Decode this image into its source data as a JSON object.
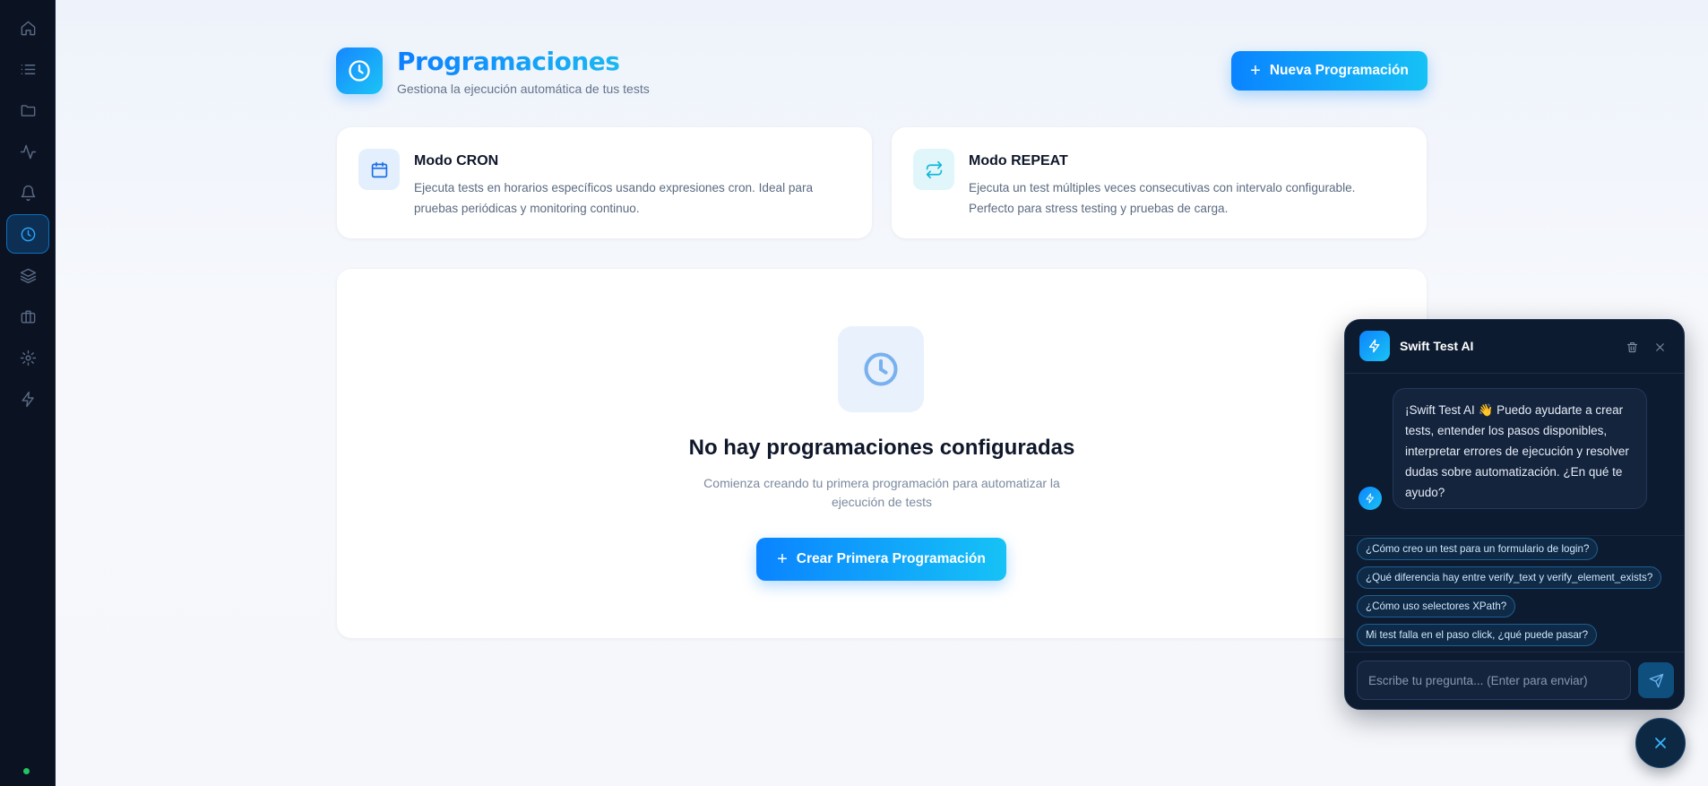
{
  "sidebar": {
    "items": [
      {
        "icon": "home-icon"
      },
      {
        "icon": "list-icon"
      },
      {
        "icon": "folder-icon"
      },
      {
        "icon": "activity-icon"
      },
      {
        "icon": "bell-icon"
      },
      {
        "icon": "clock-icon",
        "active": true
      },
      {
        "icon": "layers-icon"
      },
      {
        "icon": "briefcase-icon"
      },
      {
        "icon": "settings-icon"
      },
      {
        "icon": "zap-icon"
      }
    ],
    "status_color": "#22c55e"
  },
  "header": {
    "icon": "clock-icon",
    "title": "Programaciones",
    "subtitle": "Gestiona la ejecución automática de tus tests",
    "new_button_label": "Nueva Programación"
  },
  "modes": {
    "cron": {
      "icon": "calendar-icon",
      "title": "Modo CRON",
      "description": "Ejecuta tests en horarios específicos usando expresiones cron. Ideal para pruebas periódicas y monitoring continuo."
    },
    "repeat": {
      "icon": "repeat-icon",
      "title": "Modo REPEAT",
      "description": "Ejecuta un test múltiples veces consecutivas con intervalo configurable. Perfecto para stress testing y pruebas de carga."
    }
  },
  "empty_state": {
    "icon": "clock-icon",
    "title": "No hay programaciones configuradas",
    "description": "Comienza creando tu primera programación para automatizar la ejecución de tests",
    "button_label": "Crear Primera Programación"
  },
  "chat": {
    "title": "Swift Test AI",
    "greeting": "¡Swift Test AI 👋 Puedo ayudarte a crear tests, entender los pasos disponibles, interpretar errores de ejecución y resolver dudas sobre automatización. ¿En qué te ayudo?",
    "suggestions": [
      "¿Cómo creo un test para un formulario de login?",
      "¿Qué diferencia hay entre verify_text y verify_element_exists?",
      "¿Cómo uso selectores XPath?",
      "Mi test falla en el paso click, ¿qué puede pasar?"
    ],
    "input_placeholder": "Escribe tu pregunta... (Enter para enviar)"
  },
  "colors": {
    "accent": "#0a84ff",
    "accent_2": "#16c2f6",
    "sidebar_bg": "#0b1322",
    "chat_bg": "#0d1b31"
  }
}
